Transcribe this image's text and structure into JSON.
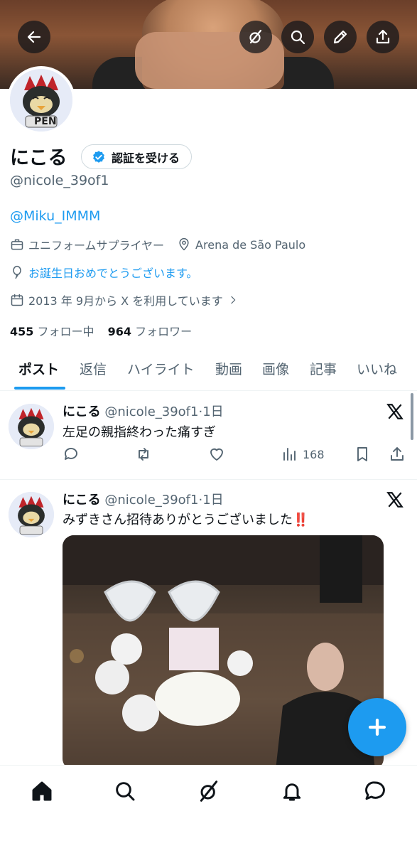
{
  "profile": {
    "name": "にこる",
    "verify_label": "認証を受ける",
    "handle": "@nicole_39of1",
    "bio": "@Miku_IMMM",
    "job": "ユニフォームサプライヤー",
    "location": "Arena de São Paulo",
    "birthday": "お誕生日おめでとうございます。",
    "joined": "2013 年 9月から X を利用しています",
    "following_count": "455",
    "following_label": "フォロー中",
    "followers_count": "964",
    "followers_label": "フォロワー",
    "avatar_text": "PEN"
  },
  "tabs": [
    "ポスト",
    "返信",
    "ハイライト",
    "動画",
    "画像",
    "記事",
    "いいね"
  ],
  "posts": [
    {
      "name": "にこる",
      "handle_time": "@nicole_39of1·1日",
      "text": "左足の親指終わった痛すぎ",
      "views": "168"
    },
    {
      "name": "にこる",
      "handle_time": "@nicole_39of1·1日",
      "text": "みずきさん招待ありがとうございました‼️"
    }
  ],
  "colors": {
    "accent": "#1d9bf0",
    "text": "#0f1419",
    "secondary": "#536471"
  },
  "icons": {
    "top_bar": [
      "back-arrow-icon",
      "grok-icon",
      "search-icon",
      "edit-icon",
      "share-icon"
    ],
    "bottom_nav": [
      "home-icon",
      "search-icon",
      "grok-icon",
      "bell-icon",
      "messages-icon"
    ]
  }
}
